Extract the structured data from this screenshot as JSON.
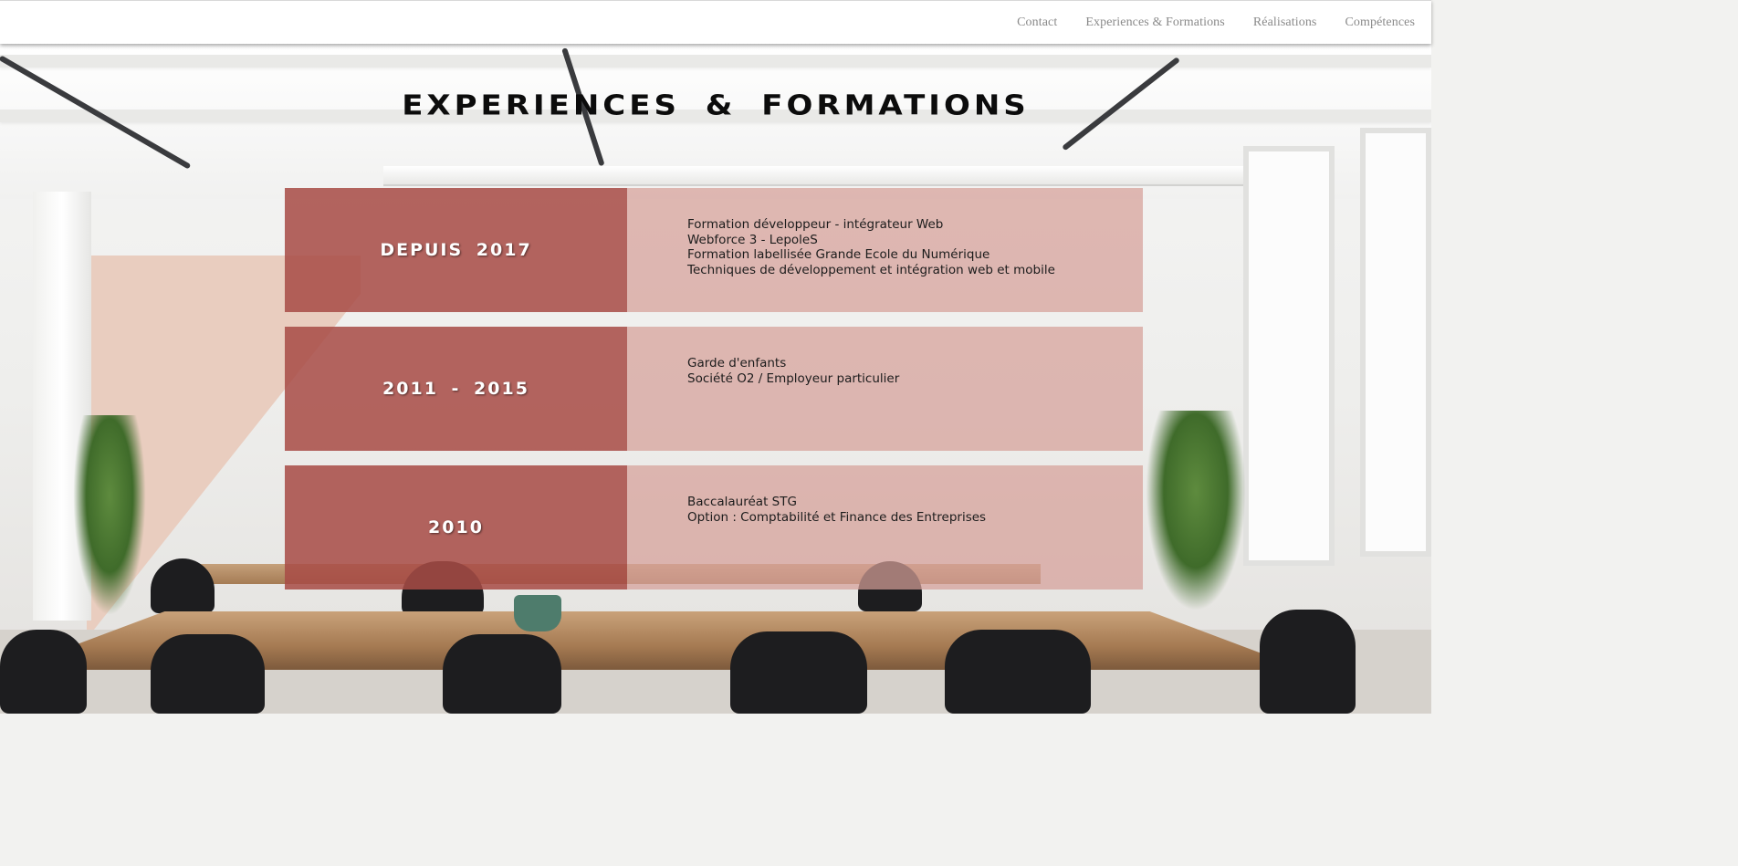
{
  "nav": {
    "items": [
      {
        "label": "Contact"
      },
      {
        "label": "Experiences & Formations"
      },
      {
        "label": "Réalisations"
      },
      {
        "label": "Compétences"
      }
    ]
  },
  "page": {
    "title": "EXPERIENCES & FORMATIONS"
  },
  "timeline": [
    {
      "date": "DEPUIS 2017",
      "lines": [
        "Formation développeur - intégrateur Web",
        "Webforce 3 - LepoleS",
        "Formation labellisée Grande Ecole du Numérique",
        "Techniques de développement et intégration web et mobile"
      ]
    },
    {
      "date": "2011 - 2015",
      "lines": [
        "Garde d'enfants",
        "Société O2 / Employeur particulier"
      ]
    },
    {
      "date": "2010",
      "lines": [
        "Baccalauréat STG",
        "Option : Comptabilité et Finance des Entreprises"
      ]
    }
  ],
  "colors": {
    "date_block": "#a84c46",
    "body_block": "#d6a098",
    "nav_text": "#8a8a8a",
    "title_text": "#0c0c0c"
  }
}
